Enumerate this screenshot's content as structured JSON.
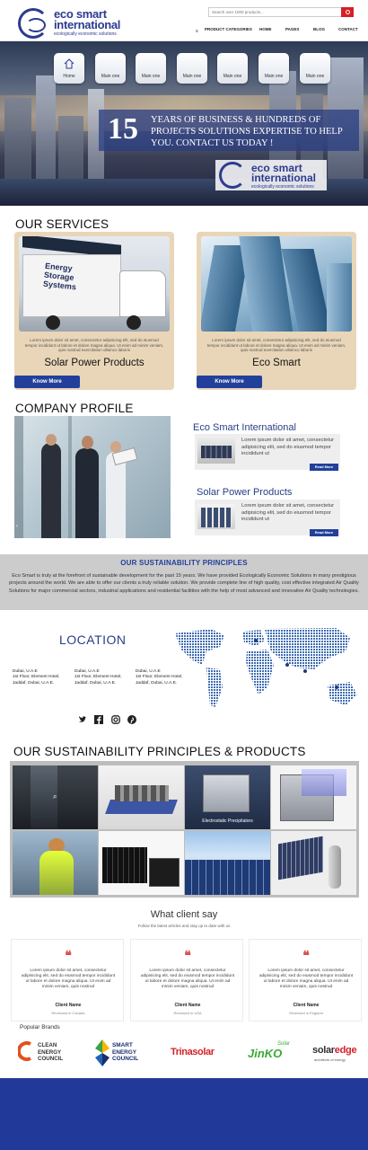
{
  "header": {
    "logo": {
      "line1": "eco smart",
      "line2": "international",
      "tagline": "ecologically economic solutions"
    },
    "search": {
      "placeholder": "Search over 1000 products..."
    },
    "nav": [
      "PRODUCT CATEGORIES",
      "HOME",
      "PAGES",
      "BLOG",
      "CONTACT"
    ]
  },
  "hero": {
    "buttons": [
      "Home",
      "Main one",
      "Main one",
      "Main one",
      "Main one",
      "Main one",
      "Main one"
    ],
    "number": "15",
    "text": "YEARS OF BUSINESS & HUNDREDS  OF PROJECTS SOLUTIONS EXPERTISE TO HELP YOU. CONTACT US TODAY !",
    "logo": {
      "line1": "eco smart",
      "line2": "international",
      "tagline": "ecologically economic solutions"
    },
    "img_text": "Energy Storage Systems"
  },
  "services": {
    "title": "OUR SERVICES",
    "cards": [
      {
        "lorem": "Lorem ipsum dolor sit amet, consectetur adipisicing elit, sed do eiusmod tempor incididunt ut labore et dolore magna aliqua. Ut enim ad minim veniam, quis nostrud exercitation ullamco laboris",
        "title": "Solar Power Products",
        "button": "Know More"
      },
      {
        "lorem": "Lorem ipsum dolor sit amet, consectetur adipisicing elit, sed do eiusmod tempor incididunt ut labore et dolore magna aliqua. Ut enim ad minim veniam, quis nostrud exercitation ullamco laboris",
        "title": "Eco Smart",
        "button": "Know More"
      }
    ]
  },
  "profile": {
    "title": "COMPANY PROFILE",
    "items": [
      {
        "heading": "Eco Smart International",
        "text": "Lorem ipsum dolor sit amet, consectetur adipisicing elit, sed do eiusmod tempor incididunt ut",
        "button": "Read More"
      },
      {
        "heading": "Solar Power Products",
        "text": "Lorem ipsum dolor sit amet, consectetur adipisicing elit, sed do eiusmod tempor incididunt ut",
        "button": "Read More"
      }
    ]
  },
  "principles": {
    "title": "OUR SUSTAINABILITY PRINCIPLES",
    "text": "Eco Smart is truly at the forefront of sustainable development for the past 15 years. We have provided Ecologically Economic Solutions in many prestigious projects around the world. We are able to offer our clients a truly reliable solution. We provide complete line of high quality, cost effective integrated Air Quality Solutions for major commercial sectors, industrial applications and residential facilities with the help of most advanced and innovative Air Quality technologies."
  },
  "location": {
    "title": "LOCATION",
    "addresses": [
      {
        "city": "Dubai, U.A.E",
        "line1": "1st Floor, Element Hotel,",
        "line2": "Jaddaf, Dubai, U.A.E."
      },
      {
        "city": "Dubai, U.A.E",
        "line1": "1st Floor, Element Hotel,",
        "line2": "Jaddaf, Dubai, U.A.E."
      },
      {
        "city": "Dubai, U.A.E",
        "line1": "1st Floor, Element Hotel,",
        "line2": "Jaddaf, Dubai, U.A.E."
      }
    ],
    "social_icons": [
      "twitter-icon",
      "facebook-icon",
      "instagram-icon",
      "pinterest-icon"
    ]
  },
  "products": {
    "title": "OUR SUSTAINABILITY PRINCIPLES & PRODUCTS",
    "tiles": [
      "",
      "",
      "Electrostatic Precipitators",
      "",
      "",
      "",
      "",
      ""
    ]
  },
  "testimonials": {
    "title": "What client say",
    "subtitle": "Follow the latest articles and stay up to date with us",
    "items": [
      {
        "quote": "Lorem ipsum dolor sit amet, consectetur adipisicing elit, sed do eiusmod tempor incididunt ut labore et dolore magna aliqua. Ut enim ad minim veniam, quis nostrud",
        "name": "Client Name",
        "location": "Reviewed in Canada"
      },
      {
        "quote": "Lorem ipsum dolor sit amet, consectetur adipisicing elit, sed do eiusmod tempor incididunt ut labore et dolore magna aliqua. Ut enim ad minim veniam, quis nostrud",
        "name": "Client Name",
        "location": "Reviewed in USA"
      },
      {
        "quote": "Lorem ipsum dolor sit amet, consectetur adipisicing elit, sed do eiusmod tempor incididunt ut labore et dolore magna aliqua. Ut enim ad minim veniam, quis nostrud",
        "name": "Client Name",
        "location": "Reviewed in England"
      }
    ]
  },
  "brands": {
    "title": "Popular Brands",
    "clean": [
      "CLEAN",
      "ENERGY",
      "COUNCIL"
    ],
    "smart": [
      "SMART",
      "ENERGY",
      "COUNCIL"
    ],
    "trina": "Trinasolar",
    "jinko": "JinKO",
    "jinko_solar": "Solar",
    "solaredge_1": "solar",
    "solaredge_2": "edge",
    "solaredge_tag": "architects of energy"
  },
  "colors": {
    "brand": "#283e86",
    "button": "#22409b",
    "accent": "#d71f26",
    "footer": "#213a9a"
  }
}
